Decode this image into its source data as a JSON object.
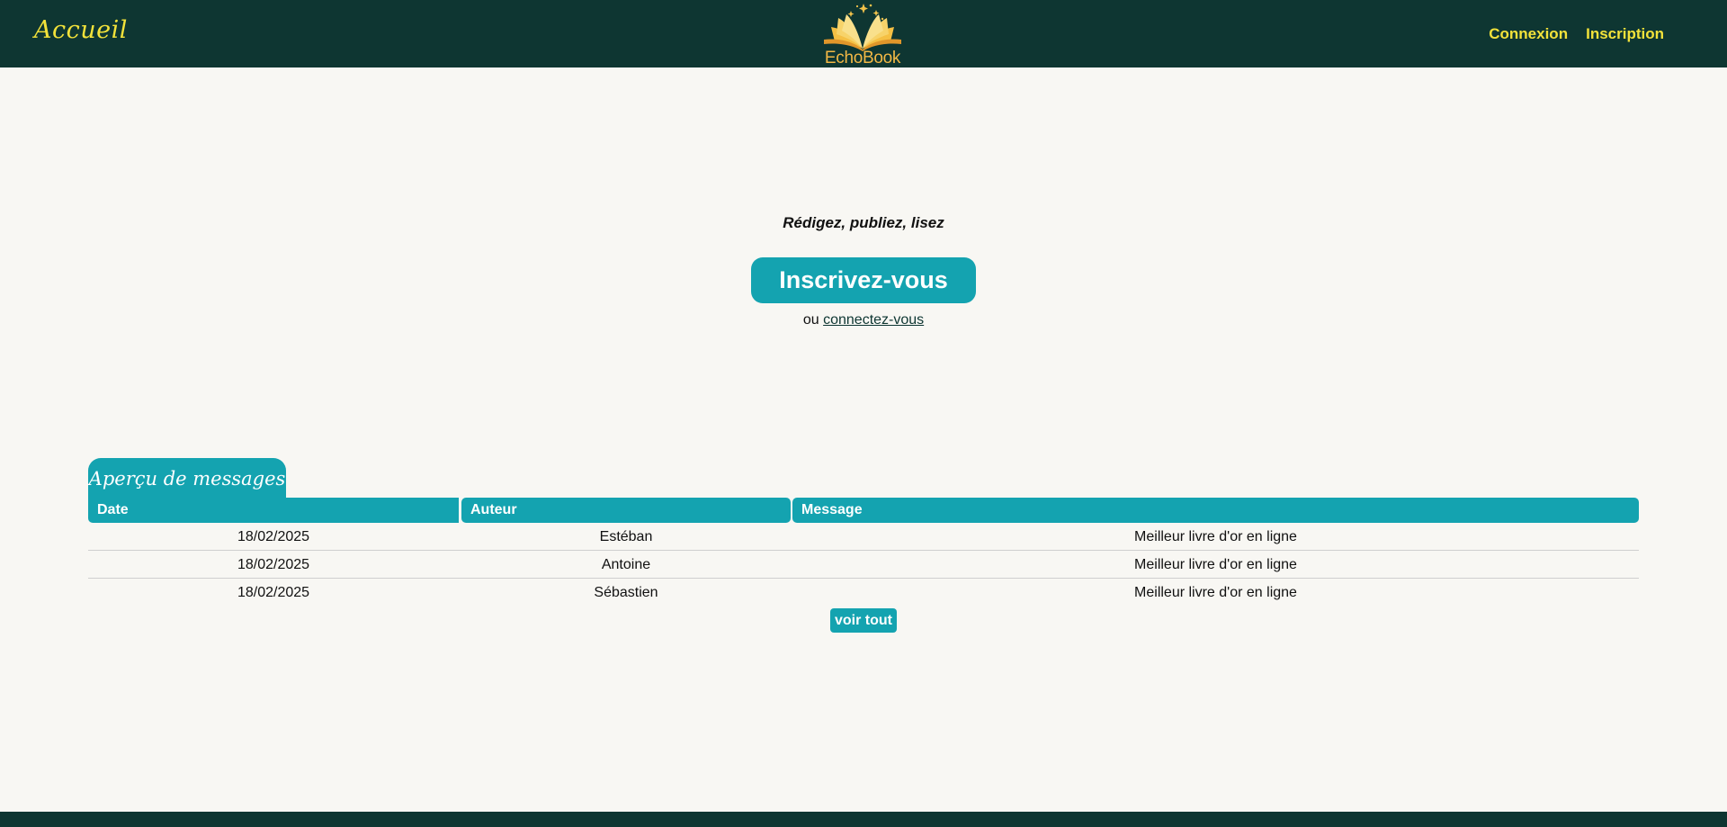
{
  "header": {
    "home_label": "Accueil",
    "logo_text_1": "Echo",
    "logo_text_2": "Book",
    "login_label": "Connexion",
    "signup_label": "Inscription"
  },
  "hero": {
    "tagline": "Rédigez, publiez, lisez",
    "cta_label": "Inscrivez-vous",
    "alt_prefix": "ou",
    "alt_link": "connectez-vous"
  },
  "messages": {
    "tab_title": "Aperçu de messages",
    "columns": [
      "Date",
      "Auteur",
      "Message"
    ],
    "rows": [
      {
        "date": "18/02/2025",
        "author": "Estéban",
        "message": "Meilleur livre d'or en ligne"
      },
      {
        "date": "18/02/2025",
        "author": "Antoine",
        "message": "Meilleur livre d'or en ligne"
      },
      {
        "date": "18/02/2025",
        "author": "Sébastien",
        "message": "Meilleur livre d'or en ligne"
      }
    ],
    "see_all_label": "voir tout"
  },
  "colors": {
    "header_bg": "#0e3632",
    "accent": "#14a3b0",
    "nav_text": "#f2e23a",
    "logo_text": "#f2b845",
    "page_bg": "#f8f7f3"
  },
  "icons": {
    "logo": "open-book-logo"
  }
}
